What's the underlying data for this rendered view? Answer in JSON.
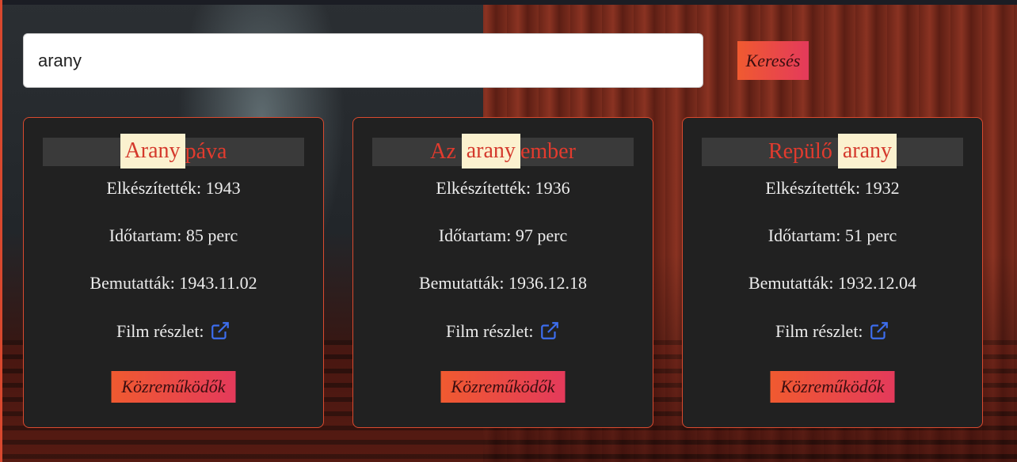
{
  "search": {
    "value": "arany",
    "button_label": "Keresés"
  },
  "films": [
    {
      "title_parts": [
        {
          "text": "Arany",
          "hl": true
        },
        {
          "text": "páva",
          "hl": false
        }
      ],
      "made": "Elkészítették: 1943",
      "duration": "Időtartam: 85 perc",
      "premiere": "Bemutatták: 1943.11.02",
      "detail": "Film részlet:",
      "contrib_label": "Közreműködők"
    },
    {
      "title_parts": [
        {
          "text": "Az",
          "hl": false
        },
        {
          "text": "arany",
          "hl": true
        },
        {
          "text": "ember",
          "hl": false
        }
      ],
      "made": "Elkészítették: 1936",
      "duration": "Időtartam: 97 perc",
      "premiere": "Bemutatták: 1936.12.18",
      "detail": "Film részlet:",
      "contrib_label": "Közreműködők"
    },
    {
      "title_parts": [
        {
          "text": "Repülő",
          "hl": false
        },
        {
          "text": "arany",
          "hl": true
        }
      ],
      "made": "Elkészítették: 1932",
      "duration": "Időtartam: 51 perc",
      "premiere": "Bemutatták: 1932.12.04",
      "detail": "Film részlet:",
      "contrib_label": "Közreműködők"
    }
  ],
  "colors": {
    "accent_start": "#f05a30",
    "accent_end": "#e43a5b",
    "title_red": "#e23b2e",
    "highlight": "#fbf1cf",
    "link_blue": "#3d6ef0"
  },
  "icons": {
    "external_link": "external-link-icon"
  }
}
